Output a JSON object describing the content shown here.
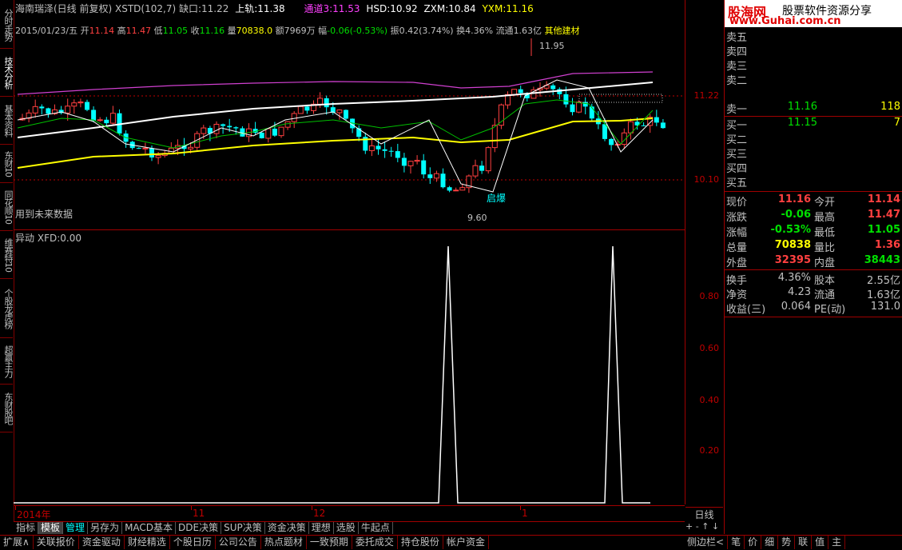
{
  "left_tabs": [
    "分时走势",
    "技术分析",
    "基本资料",
    "东财10",
    "同花顺10",
    "维赛特10",
    "个股龙虎榜",
    "超赢主力",
    "东财股吧"
  ],
  "header": {
    "stock": "海南瑞泽(日线 前复权)",
    "indicator": "XSTD(102,7)",
    "gap_label": "缺口:",
    "gap_value": "11.22",
    "upper_label": "上轨:",
    "upper_value": "11.38",
    "channel_label": "通道3:",
    "channel_value": "11.53",
    "hsd_label": "HSD:",
    "hsd_value": "10.92",
    "zxm_label": "ZXM:",
    "zxm_value": "10.84",
    "yxm_label": "YXM:",
    "yxm_value": "11.16"
  },
  "info": {
    "date": "2015/01/23/五",
    "open_label": "开",
    "open": "11.14",
    "high_label": "高",
    "high": "11.47",
    "low_label": "低",
    "low": "11.05",
    "close_label": "收",
    "close": "11.16",
    "vol_label": "量",
    "vol": "70838.0",
    "amt_label": "额",
    "amt": "7969万",
    "chg_label": "幅",
    "chg": "-0.06(-0.53%)",
    "amp_label": "振",
    "amp": "0.42(3.74%)",
    "turn_label": "换",
    "turn": "4.36%",
    "float_label": "流通",
    "float": "1.63亿",
    "sector": "其他建材"
  },
  "main_chart": {
    "y_ticks": [
      "11.22",
      "10.10"
    ],
    "annot_high": "11.95",
    "annot_low": "9.60",
    "annot_signal": "启爆",
    "future_text": "用到未来数据"
  },
  "sub_chart": {
    "title": "异动",
    "xfd_label": "XFD:",
    "xfd_value": "0.00",
    "y_ticks": [
      "0.80",
      "0.60",
      "0.40",
      "0.20"
    ]
  },
  "time_axis": {
    "labels": [
      "2014年",
      "11",
      "12",
      "1"
    ],
    "period": "日线"
  },
  "logo": {
    "brand": "股海网",
    "slogan": "股票软件资源分享",
    "url": "www.Guhai.com.cn"
  },
  "orderbook": {
    "sell": [
      {
        "label": "卖五",
        "price": "",
        "vol": ""
      },
      {
        "label": "卖四",
        "price": "",
        "vol": ""
      },
      {
        "label": "卖三",
        "price": "",
        "vol": ""
      },
      {
        "label": "卖二",
        "price": "",
        "vol": ""
      },
      {
        "label": "卖一",
        "price": "11.16",
        "vol": "118"
      }
    ],
    "buy": [
      {
        "label": "买一",
        "price": "11.15",
        "vol": "7"
      },
      {
        "label": "买二",
        "price": "",
        "vol": ""
      },
      {
        "label": "买三",
        "price": "",
        "vol": ""
      },
      {
        "label": "买四",
        "price": "",
        "vol": ""
      },
      {
        "label": "买五",
        "price": "",
        "vol": ""
      }
    ]
  },
  "quote": [
    {
      "l1": "现价",
      "v1": "11.16",
      "c1": "#ff4040",
      "l2": "今开",
      "v2": "11.14",
      "c2": "#ff4040"
    },
    {
      "l1": "涨跌",
      "v1": "-0.06",
      "c1": "#00e000",
      "l2": "最高",
      "v2": "11.47",
      "c2": "#ff4040"
    },
    {
      "l1": "涨幅",
      "v1": "-0.53%",
      "c1": "#00e000",
      "l2": "最低",
      "v2": "11.05",
      "c2": "#00e000"
    },
    {
      "l1": "总量",
      "v1": "70838",
      "c1": "#ffff00",
      "l2": "量比",
      "v2": "1.36",
      "c2": "#ff4040"
    },
    {
      "l1": "外盘",
      "v1": "32395",
      "c1": "#ff4040",
      "l2": "内盘",
      "v2": "38443",
      "c2": "#00e000"
    }
  ],
  "fundamentals": [
    {
      "l1": "换手",
      "v1": "4.36%",
      "l2": "股本",
      "v2": "2.55亿"
    },
    {
      "l1": "净资",
      "v1": "4.23",
      "l2": "流通",
      "v2": "1.63亿"
    },
    {
      "l1": "收益(三)",
      "v1": "0.064",
      "l2": "PE(动)",
      "v2": "131.0"
    }
  ],
  "tabs": [
    "指标",
    "模板",
    "管理",
    "另存为",
    "MACD基本",
    "DDE决策",
    "SUP决策",
    "资金决策",
    "理想",
    "选股",
    "牛起点"
  ],
  "active_tab": "模板",
  "status": [
    "扩展∧",
    "关联报价",
    "资金驱动",
    "财经精选",
    "个股日历",
    "公司公告",
    "热点题材",
    "一致预期",
    "委托成交",
    "持仓股份",
    "帐户资金"
  ],
  "status_right": [
    "侧边栏<",
    "笔",
    "价",
    "细",
    "势",
    "联",
    "值",
    "主"
  ],
  "controls": [
    "+",
    "-",
    "↑",
    "↓"
  ],
  "colors": {
    "up": "#ff4040",
    "down": "#00ffff",
    "vol": "#ffff00",
    "frame": "#a00000"
  }
}
